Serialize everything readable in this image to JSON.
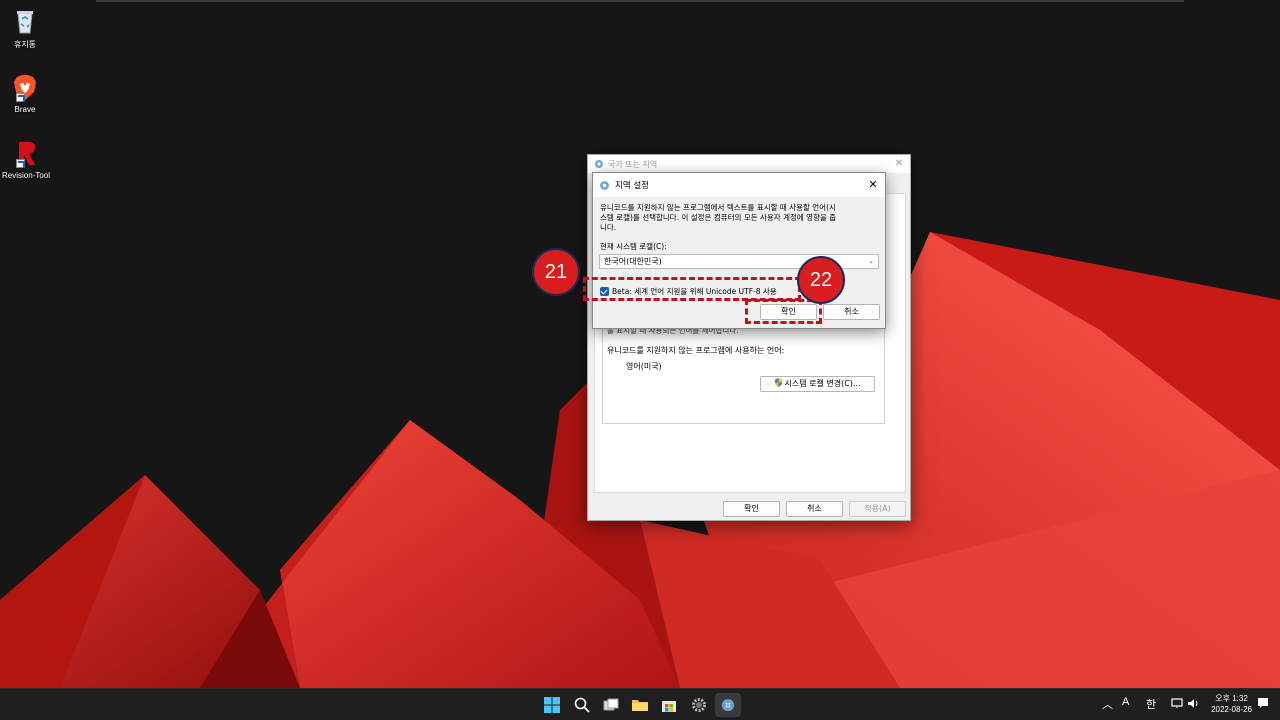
{
  "desktop": {
    "icons": [
      {
        "label": "휴지통",
        "icon": "recycle-bin-icon"
      },
      {
        "label": "Brave",
        "icon": "brave-lion-icon"
      },
      {
        "label": "Revision-Tool",
        "icon": "revision-tool-icon"
      }
    ]
  },
  "region_dialog": {
    "title": "국가 또는 지역",
    "faded_text": "을 표시할 때 사용되는 언어를 제어합니다.",
    "unicode_lang_label": "유니코드를 지원하지 않는 프로그램에 사용하는 언어:",
    "unicode_lang_value": "영어(미국)",
    "change_locale_button": "시스템 로캘 변경(C)...",
    "ok_button": "확인",
    "cancel_button": "취소",
    "apply_button": "적용(A)"
  },
  "locale_dialog": {
    "title": "지역 설정",
    "description_line1": "유니코드를 지원하지 않는 프로그램에서 텍스트를 표시할 때 사용할 언어(시",
    "description_line2": "스템 로캘)를 선택합니다. 이 설정은 컴퓨터의 모든 사용자 계정에 영향을 줍",
    "description_line3": "니다.",
    "current_locale_label": "현재 시스템 로캘(C):",
    "current_locale_value": "한국어(대한민국)",
    "beta_checkbox_label": "Beta: 세계 언어 지원을 위해 Unicode UTF-8 사용",
    "beta_checked": true,
    "ok_button": "확인",
    "cancel_button": "취소"
  },
  "annotations": {
    "step_a": "21",
    "step_b": "22",
    "color": "#d81e1e"
  },
  "taskbar": {
    "ime_mode": "A",
    "ime_lang": "한",
    "time": "오후 1:32",
    "date": "2022-08-26"
  }
}
